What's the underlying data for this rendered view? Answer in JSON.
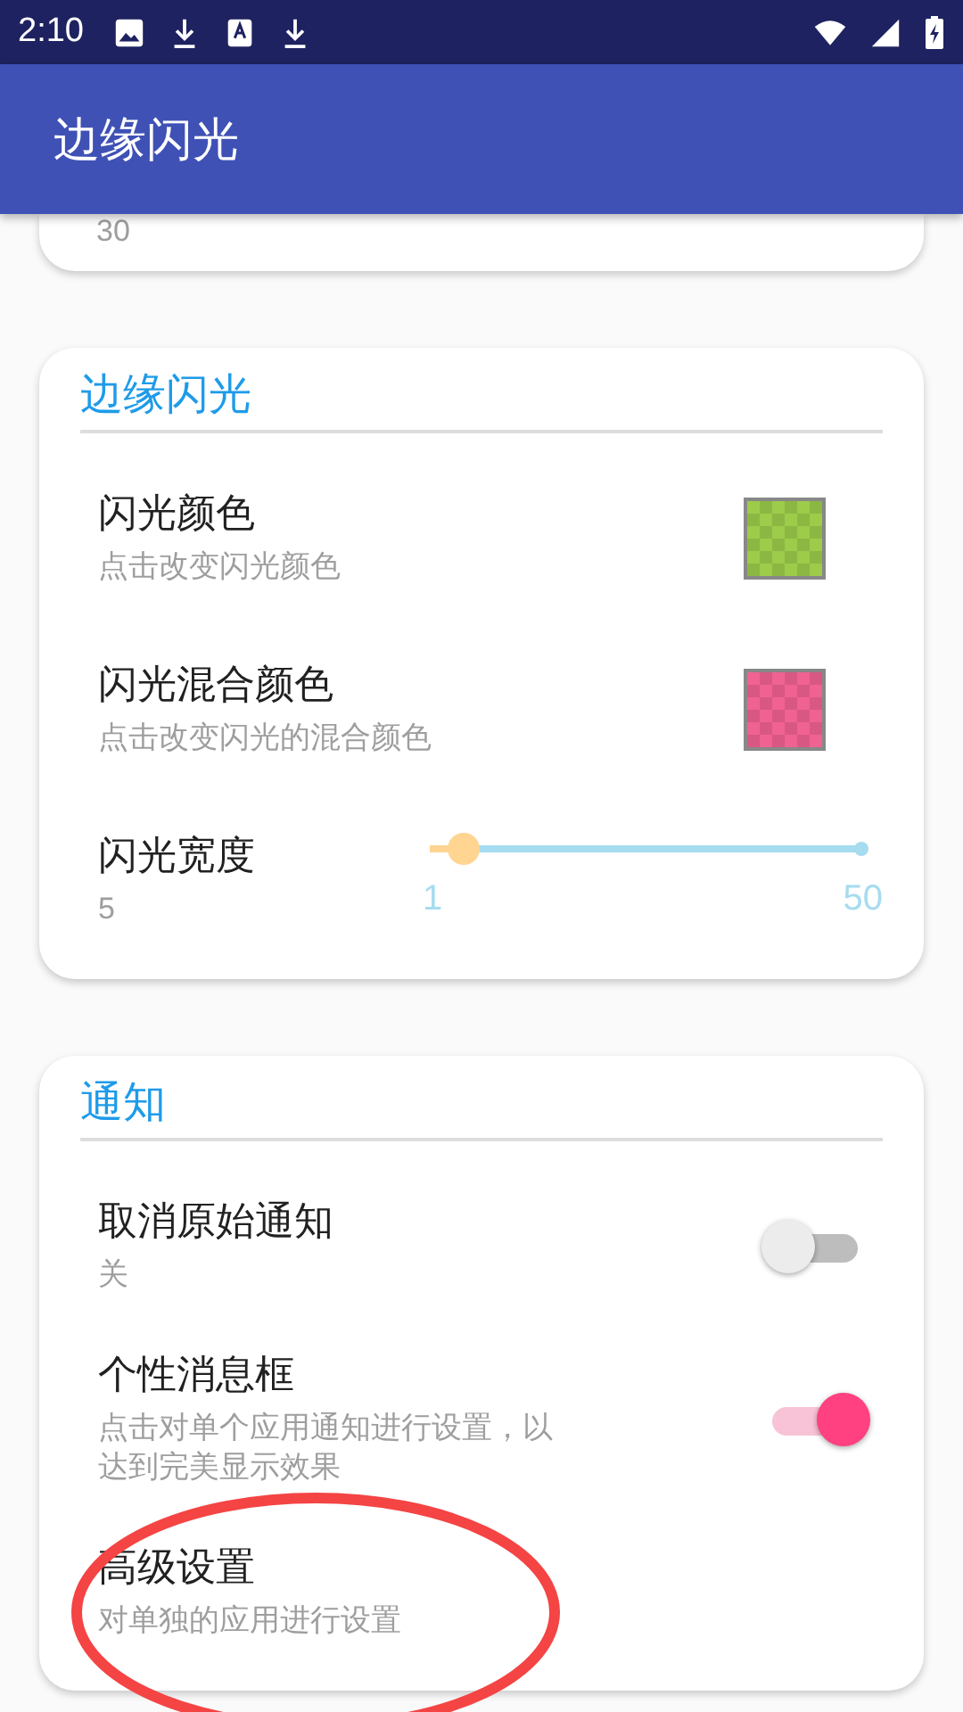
{
  "status_bar": {
    "time": "2:10"
  },
  "app_bar": {
    "title": "边缘闪光"
  },
  "partial_card": {
    "value": "30"
  },
  "sections": [
    {
      "title": "边缘闪光",
      "items": [
        {
          "kind": "color",
          "title": "闪光颜色",
          "subtitle": "点击改变闪光颜色",
          "color": "#9ccc4a"
        },
        {
          "kind": "color",
          "title": "闪光混合颜色",
          "subtitle": "点击改变闪光的混合颜色",
          "color": "#f06292"
        },
        {
          "kind": "slider",
          "title": "闪光宽度",
          "value": "5",
          "min_label": "1",
          "max_label": "50",
          "level": 0.08
        }
      ]
    },
    {
      "title": "通知",
      "items": [
        {
          "kind": "switch",
          "title": "取消原始通知",
          "subtitle": "关",
          "on": false
        },
        {
          "kind": "switch",
          "title": "个性消息框",
          "subtitle": "点击对单个应用通知进行设置，以达到完美显示效果",
          "on": true
        },
        {
          "kind": "link",
          "title": "高级设置",
          "subtitle": "对单独的应用进行设置"
        }
      ]
    }
  ]
}
